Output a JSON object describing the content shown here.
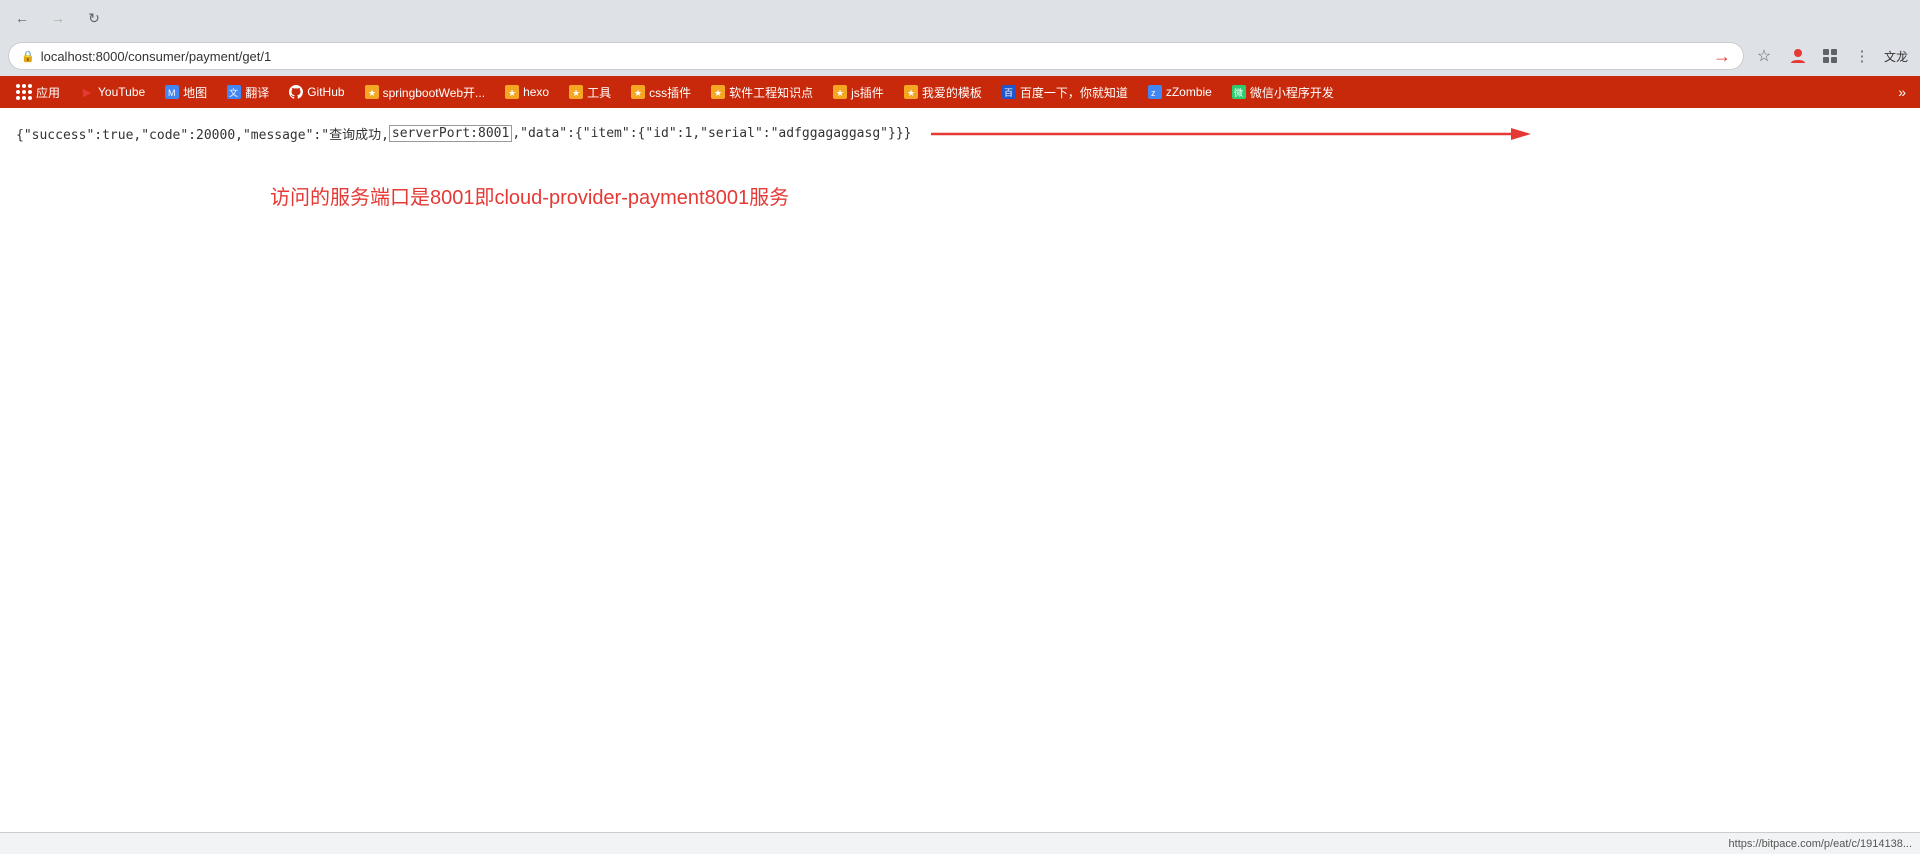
{
  "browser": {
    "url": "localhost:8000/consumer/payment/get/1",
    "back_disabled": false,
    "forward_disabled": true,
    "lang": "文龙"
  },
  "bookmarks": {
    "apps_label": "应用",
    "items": [
      {
        "label": "YouTube",
        "color": "#e53935",
        "icon": "▶"
      },
      {
        "label": "地图",
        "color": "#4285f4",
        "icon": "M"
      },
      {
        "label": "翻译",
        "color": "#4285f4",
        "icon": "文"
      },
      {
        "label": "GitHub",
        "color": "#333",
        "icon": "⊙"
      },
      {
        "label": "springbootWeb开...",
        "color": "#f5a623",
        "icon": "★"
      },
      {
        "label": "hexo",
        "color": "#f5a623",
        "icon": "★"
      },
      {
        "label": "工具",
        "color": "#f5a623",
        "icon": "★"
      },
      {
        "label": "css插件",
        "color": "#f5a623",
        "icon": "★"
      },
      {
        "label": "软件工程知识点",
        "color": "#f5a623",
        "icon": "★"
      },
      {
        "label": "js插件",
        "color": "#f5a623",
        "icon": "★"
      },
      {
        "label": "我爱的模板",
        "color": "#f5a623",
        "icon": "★"
      },
      {
        "label": "百度一下，你就知道",
        "color": "#4285f4",
        "icon": "百"
      },
      {
        "label": "zZombie",
        "color": "#4285f4",
        "icon": "z"
      },
      {
        "label": "微信小程序开发",
        "color": "#2ecc71",
        "icon": "微"
      },
      {
        "label": "»",
        "color": "#fff",
        "icon": ""
      }
    ]
  },
  "response": {
    "json_before_highlight": "{\"success\":true,\"code\":20000,\"message\":\"查询成功,",
    "highlighted": "serverPort:8001",
    "json_after_highlight": ",\"data\":{\"item\":{\"id\":1,\"serial\":\"adfggagaggasg\"}}}",
    "annotation": "访问的服务端口是8001即cloud-provider-payment8001服务"
  },
  "status_bar": {
    "url": "https://bitpace.com/p/eat/c/1914138..."
  }
}
